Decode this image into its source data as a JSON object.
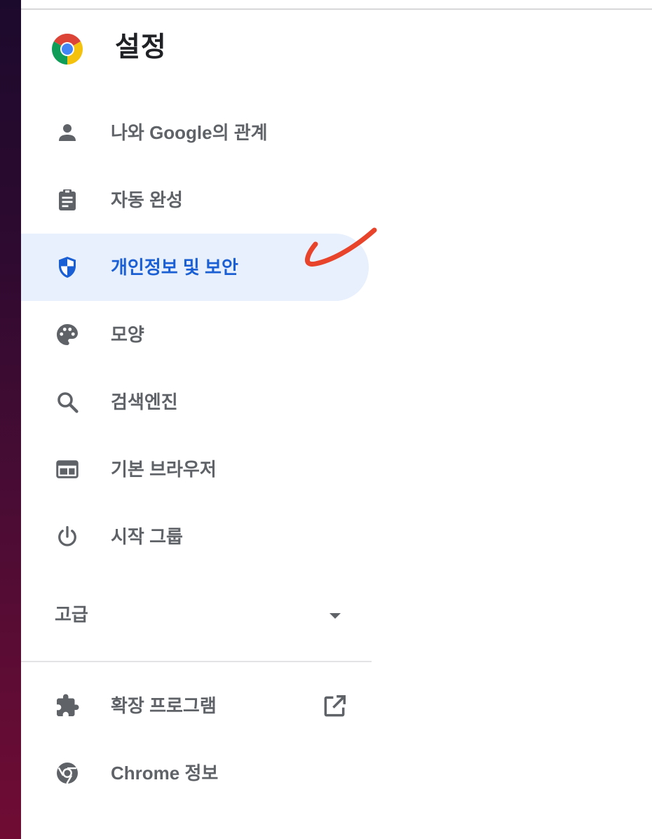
{
  "header": {
    "title": "설정"
  },
  "nav": {
    "items": [
      {
        "label": "나와 Google의 관계",
        "icon": "person-icon"
      },
      {
        "label": "자동 완성",
        "icon": "clipboard-icon"
      },
      {
        "label": "개인정보 및 보안",
        "icon": "shield-icon",
        "active": true
      },
      {
        "label": "모양",
        "icon": "palette-icon"
      },
      {
        "label": "검색엔진",
        "icon": "search-icon"
      },
      {
        "label": "기본 브라우저",
        "icon": "browser-window-icon"
      },
      {
        "label": "시작 그룹",
        "icon": "power-icon"
      }
    ]
  },
  "advanced": {
    "label": "고급"
  },
  "bottom": {
    "extensions_label": "확장 프로그램",
    "about_label": "Chrome 정보"
  },
  "colors": {
    "active_bg": "#e8f0fd",
    "active_text": "#1a5fd4",
    "text": "#5f6368",
    "annotation": "#e8442c"
  }
}
